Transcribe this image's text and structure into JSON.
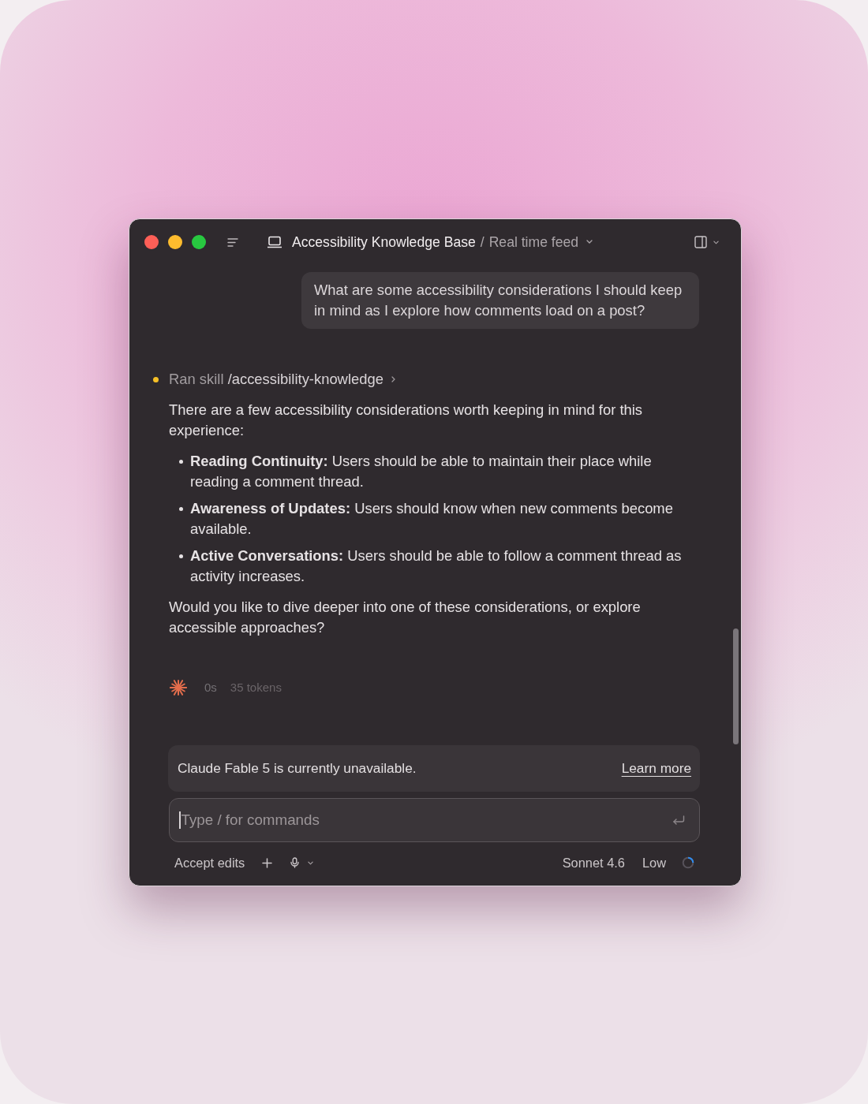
{
  "window": {
    "title": "Accessibility Knowledge Base",
    "separator": "/",
    "subtitle": "Real time feed"
  },
  "conversation": {
    "user_message": "What are some accessibility considerations I should keep in mind as I explore how comments load on a post?",
    "skill": {
      "label": "Ran skill",
      "name": "/accessibility-knowledge"
    },
    "reply": {
      "intro": "There are a few accessibility considerations worth keeping in mind for this experience:",
      "bullets": [
        "**Reading Continuity:** Users should be able to maintain their place while reading a comment thread.",
        "**Awareness of Updates:** Users should know when new comments become available.",
        "**Active Conversations:** Users should be able to follow a comment thread as activity increases."
      ],
      "closing": "Would you like to dive deeper into one of these considerations, or explore accessible approaches?"
    },
    "status": {
      "elapsed": "0s",
      "tokens": "35 tokens"
    }
  },
  "notice": {
    "text": "Claude Fable 5 is currently unavailable.",
    "link": "Learn more"
  },
  "composer": {
    "placeholder": "Type / for commands"
  },
  "toolbar": {
    "mode": "Accept edits",
    "model": "Sonnet 4.6",
    "effort": "Low"
  }
}
